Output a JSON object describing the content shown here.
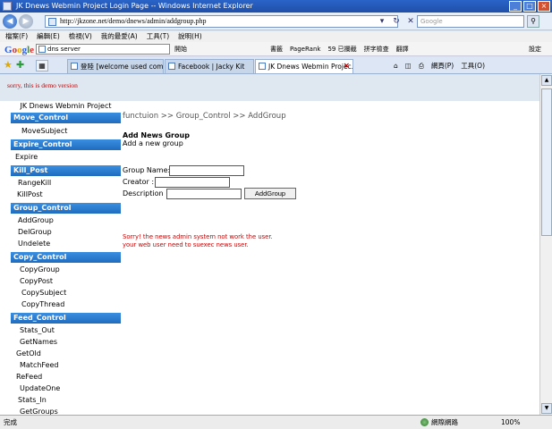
{
  "window": {
    "title": "JK Dnews Webmin Project Login Page -- Windows Internet Explorer"
  },
  "address": {
    "url": "http://jkzone.net/demo/dnews/admin/addgroup.php",
    "search_placeholder": "Google"
  },
  "menu": [
    "檔案(F)",
    "編輯(E)",
    "檢視(V)",
    "我的最愛(A)",
    "工具(T)",
    "說明(H)"
  ],
  "google_toolbar": {
    "search_value": "dns server",
    "tools": [
      "開始",
      "書籤",
      "PageRank",
      "59 已攔截",
      "拼字檢查",
      "翻譯"
    ],
    "settings": "設定"
  },
  "tabs": [
    {
      "label": "登陸 [welcome used compa..."
    },
    {
      "label": "Facebook | Jacky Kit"
    },
    {
      "label": "JK Dnews Webmin Projec..."
    }
  ],
  "command_bar": [
    "網頁(P)",
    "工具(O)"
  ],
  "banner": {
    "text": "sorry, this is demo version"
  },
  "sidebar": {
    "title": "JK Dnews Webmin Project",
    "sections": {
      "move": "Move_Control",
      "expire": "Expire_Control",
      "kill": "Kill_Post",
      "group": "Group_Control",
      "copy": "Copy_Control",
      "feed": "Feed_Control"
    },
    "items": {
      "move_subject": "MoveSubject",
      "expire": "Expire",
      "range_kill": "RangeKill",
      "kill_post": "KillPost",
      "add_group": "AddGroup",
      "del_group": "DelGroup",
      "undelete": "Undelete",
      "copy_group": "CopyGroup",
      "copy_post": "CopyPost",
      "copy_subject": "CopySubject",
      "copy_thread": "CopyThread",
      "stats_out": "Stats_Out",
      "get_names": "GetNames",
      "get_old": "GetOld",
      "match_feed": "MatchFeed",
      "refeed": "ReFeed",
      "update_one": "UpdateOne",
      "stats_in": "Stats_In",
      "get_groups": "GetGroups"
    }
  },
  "main": {
    "breadcrumb": "functuion >> Group_Control >> AddGroup",
    "heading": "Add News Group",
    "subheading": "Add a new group",
    "form": {
      "group_name_label": "Group Name:",
      "creator_label": "Creator :",
      "description_label": "Description :",
      "group_name_value": "",
      "creator_value": "",
      "description_value": "",
      "submit_label": "AddGroup"
    },
    "error_line1": "Sorry! the news admin system not work the user.",
    "error_line2": "your web user need to suexec news user."
  },
  "status": {
    "left": "完成",
    "zone": "網際網路",
    "zoom": "100%"
  }
}
